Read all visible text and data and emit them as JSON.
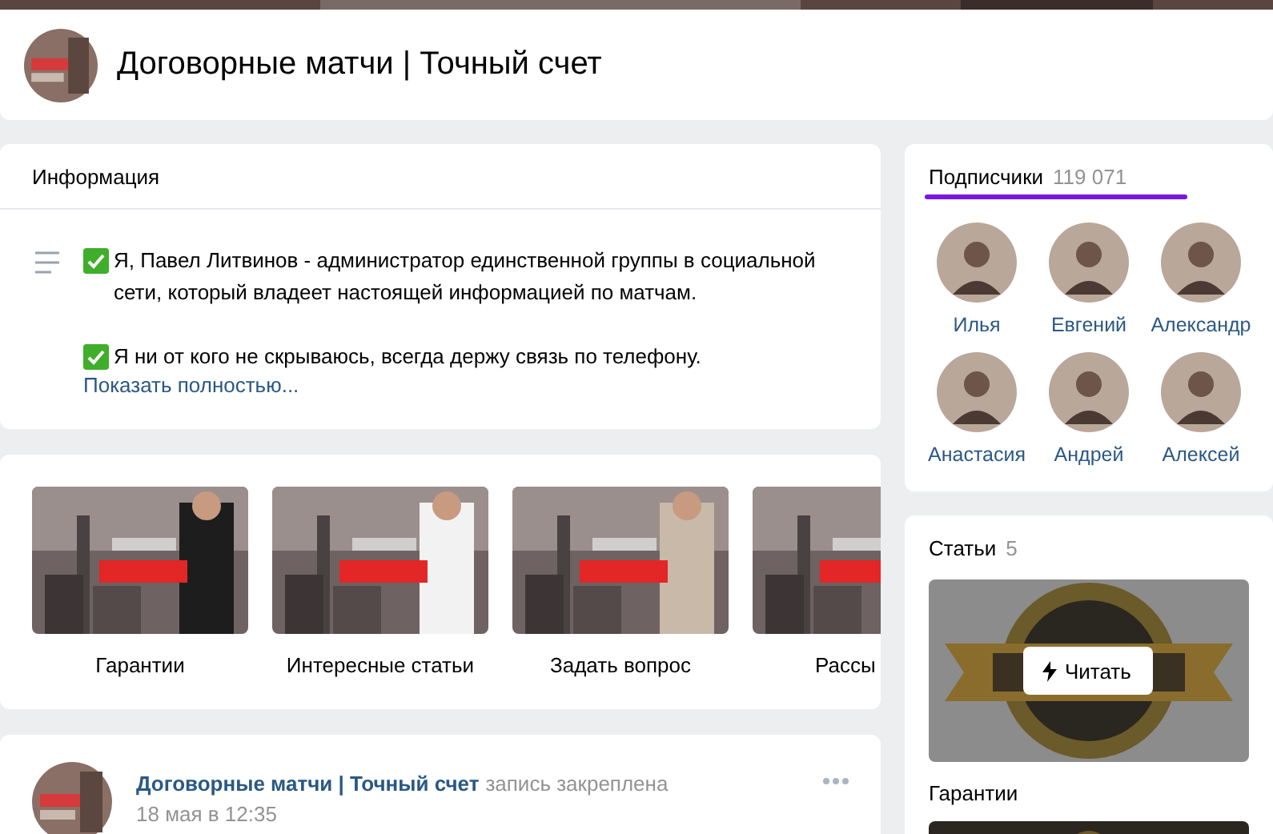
{
  "group": {
    "title": "Договорные матчи | Точный счет"
  },
  "info": {
    "title": "Информация",
    "paragraphs": [
      "Я, Павел Литвинов - администратор единственной группы в социальной сети, который владеет настоящей информацией по матчам.",
      "Я ни от кого не скрываюсь, всегда держу связь по телефону."
    ],
    "more_link": "Показать полностью..."
  },
  "menu": [
    {
      "label": "Гарантии"
    },
    {
      "label": "Интересные статьи"
    },
    {
      "label": "Задать вопрос"
    },
    {
      "label": "Рассы"
    }
  ],
  "post": {
    "author": "Договорные матчи | Точный счет",
    "note": "запись закреплена",
    "date": "18 мая в 12:35"
  },
  "subscribers": {
    "title": "Подписчики",
    "count": "119 071",
    "people": [
      {
        "name": "Илья"
      },
      {
        "name": "Евгений"
      },
      {
        "name": "Александр"
      },
      {
        "name": "Анастасия"
      },
      {
        "name": "Андрей"
      },
      {
        "name": "Алексей"
      }
    ]
  },
  "articles": {
    "title": "Статьи",
    "count": "5",
    "read_button": "Читать",
    "items": [
      {
        "title": "Гарантии"
      }
    ]
  }
}
